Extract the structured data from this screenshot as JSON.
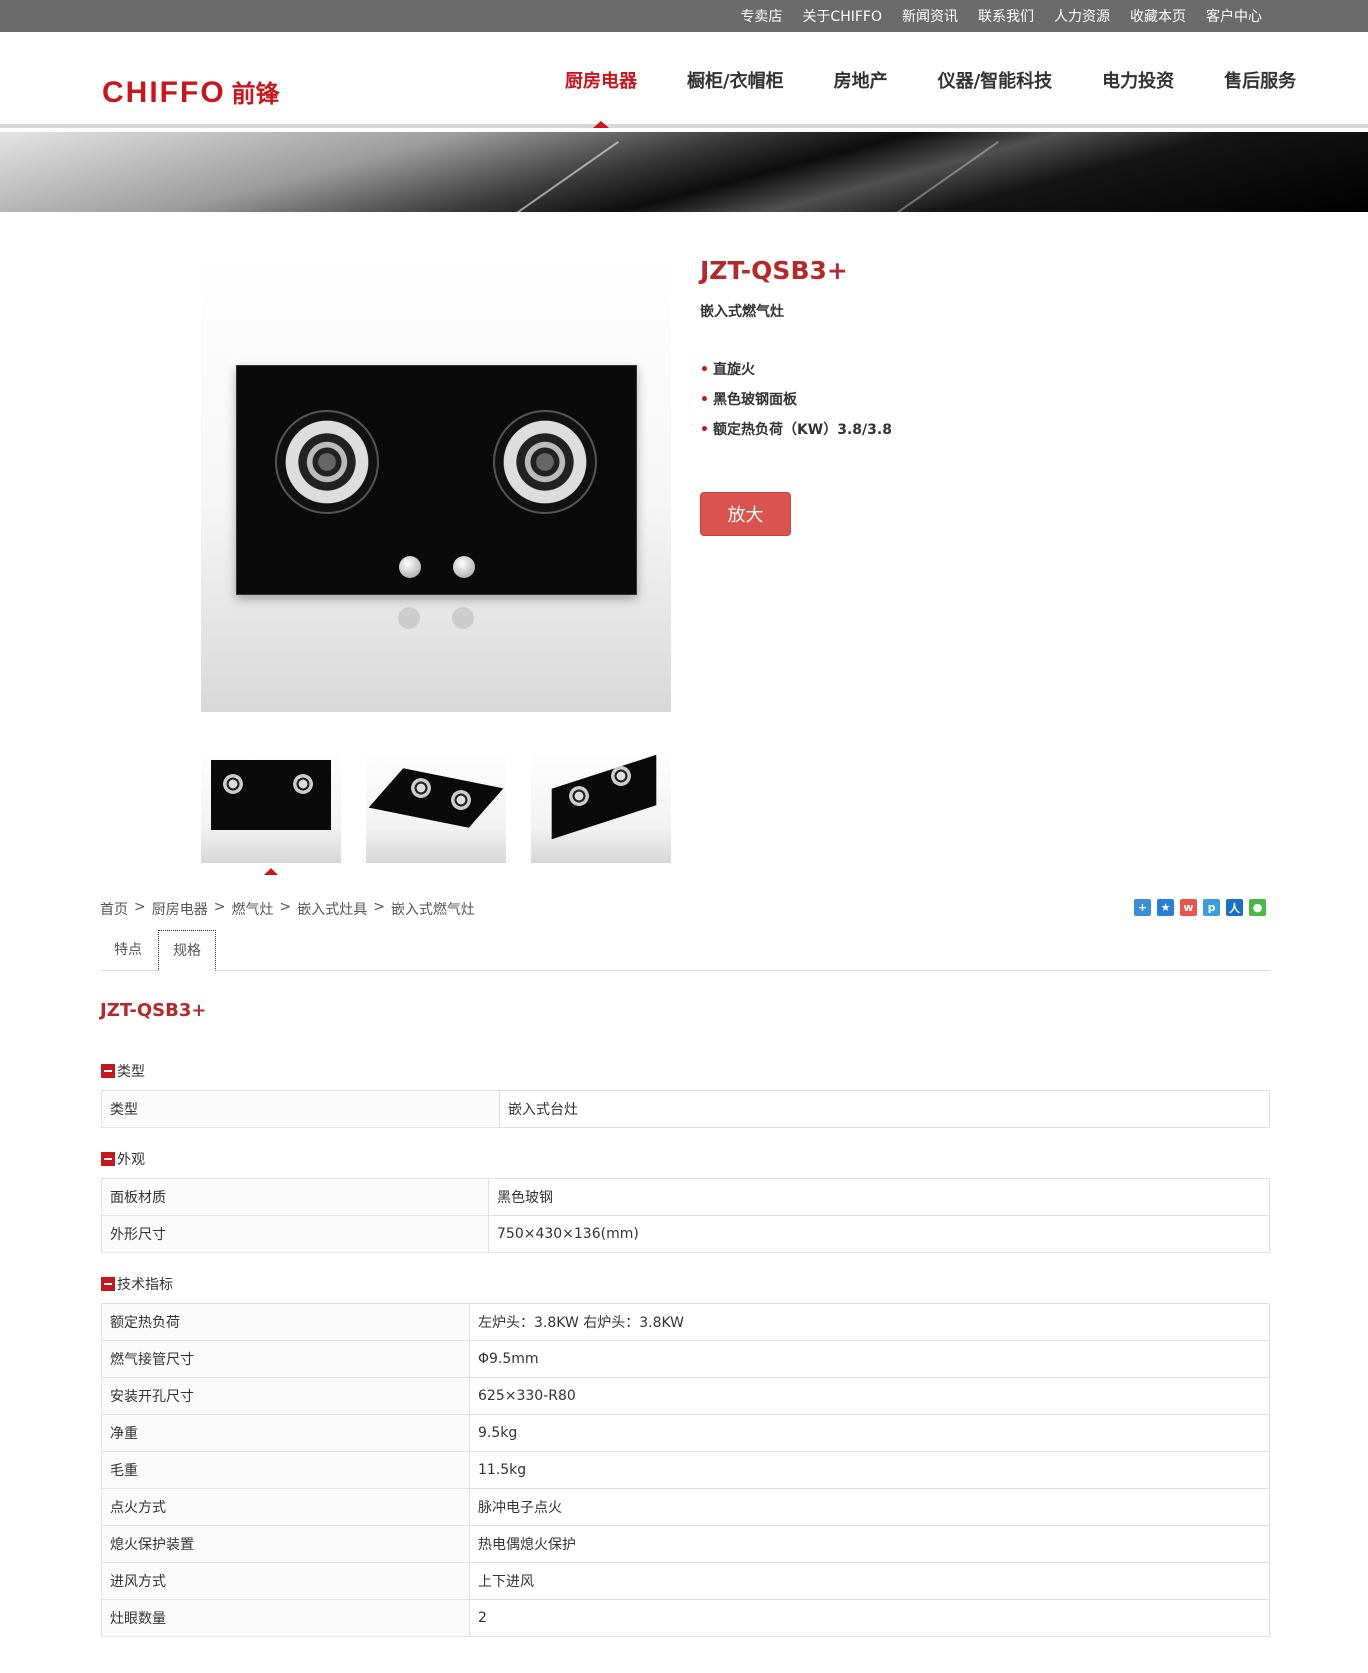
{
  "topbar": {
    "links": [
      "专卖店",
      "关于CHIFFO",
      "新闻资讯",
      "联系我们",
      "人力资源",
      "收藏本页",
      "客户中心"
    ]
  },
  "header": {
    "logo_en": "CHIFFO",
    "logo_cn": "前锋",
    "nav": [
      "厨房电器",
      "橱柜/衣帽柜",
      "房地产",
      "仪器/智能科技",
      "电力投资",
      "售后服务"
    ],
    "active_nav": "厨房电器"
  },
  "product": {
    "model": "JZT-QSB3+",
    "subtitle": "嵌入式燃气灶",
    "features": [
      "直旋火",
      "黑色玻钢面板",
      "额定热负荷（KW）3.8/3.8"
    ],
    "zoom_label": "放大"
  },
  "breadcrumb": [
    "首页",
    "厨房电器",
    "燃气灶",
    "嵌入式灶具",
    "嵌入式燃气灶"
  ],
  "share_icons": [
    "share-more-icon",
    "qzone-icon",
    "weibo-icon",
    "tencent-weibo-icon",
    "renren-icon",
    "wechat-icon"
  ],
  "tabs": [
    "特点",
    "规格"
  ],
  "active_tab": "规格",
  "spec": {
    "model": "JZT-QSB3+",
    "sections": [
      {
        "title": "类型",
        "rows": [
          [
            "类型",
            "嵌入式台灶"
          ]
        ]
      },
      {
        "title": "外观",
        "rows": [
          [
            "面板材质",
            "黑色玻钢"
          ],
          [
            "外形尺寸",
            "750×430×136(mm)"
          ]
        ]
      },
      {
        "title": "技术指标",
        "rows": [
          [
            "额定热负荷",
            "左炉头：3.8KW 右炉头：3.8KW"
          ],
          [
            "燃气接管尺寸",
            "Φ9.5mm"
          ],
          [
            "安装开孔尺寸",
            "625×330-R80"
          ],
          [
            "净重",
            "9.5kg"
          ],
          [
            "毛重",
            "11.5kg"
          ],
          [
            "点火方式",
            "脉冲电子点火"
          ],
          [
            "熄火保护装置",
            "热电偶熄火保护"
          ],
          [
            "进风方式",
            "上下进风"
          ],
          [
            "灶眼数量",
            "2"
          ]
        ]
      }
    ]
  },
  "colors": {
    "brand_red": "#c8161d",
    "model_red": "#b22a2a",
    "button_red": "#d9534f",
    "topbar_gray": "#6b6b6b"
  }
}
